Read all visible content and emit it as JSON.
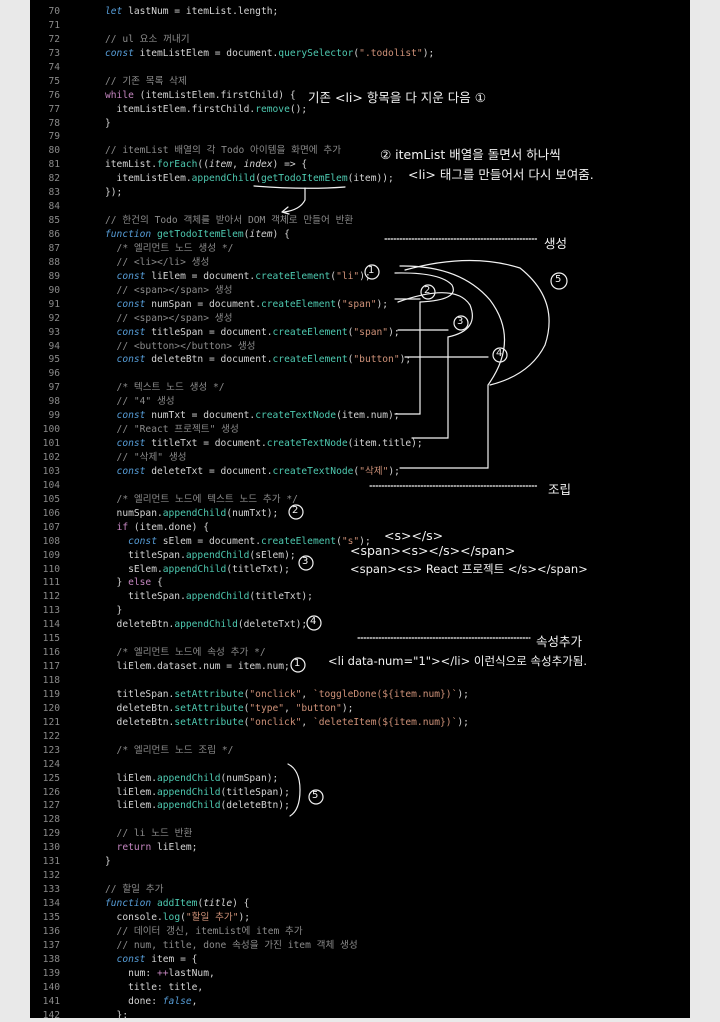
{
  "colors": {
    "background": "#000000",
    "margin": "#e9e9e9",
    "keyword": "#569cd6",
    "function": "#4ec9b0",
    "string": "#ce9178",
    "comment": "#8b8b8b",
    "text": "#d4d4d4",
    "line_number": "#8a8a8a",
    "annotation": "#f2f2f2"
  },
  "code": {
    "lines": [
      {
        "n": "70",
        "tokens": [
          [
            "let",
            "kw"
          ],
          [
            " lastNum = itemList.length;",
            ""
          ]
        ]
      },
      {
        "n": "71",
        "tokens": []
      },
      {
        "n": "72",
        "tokens": [
          [
            "// ul 요소 꺼내기",
            "cm"
          ]
        ]
      },
      {
        "n": "73",
        "tokens": [
          [
            "const",
            "kw"
          ],
          [
            " itemListElem = document.",
            ""
          ],
          [
            "querySelector",
            "fn"
          ],
          [
            "(",
            ""
          ],
          [
            "\".todolist\"",
            "str"
          ],
          [
            ");",
            ""
          ]
        ]
      },
      {
        "n": "74",
        "tokens": []
      },
      {
        "n": "75",
        "tokens": [
          [
            "// 기존 목록 삭제",
            "cm"
          ]
        ]
      },
      {
        "n": "76",
        "tokens": [
          [
            "while",
            "kw2"
          ],
          [
            " (itemListElem.firstChild) {",
            ""
          ]
        ]
      },
      {
        "n": "77",
        "tokens": [
          [
            "  itemListElem.firstChild.",
            ""
          ],
          [
            "remove",
            "fn"
          ],
          [
            "();",
            ""
          ]
        ]
      },
      {
        "n": "78",
        "tokens": [
          [
            "}",
            ""
          ]
        ]
      },
      {
        "n": "79",
        "tokens": []
      },
      {
        "n": "80",
        "tokens": [
          [
            "// itemList 배열의 각 Todo 아이템을 화면에 추가",
            "cm"
          ]
        ]
      },
      {
        "n": "81",
        "tokens": [
          [
            "itemList.",
            ""
          ],
          [
            "forEach",
            "fn"
          ],
          [
            "((",
            ""
          ],
          [
            "item",
            "param"
          ],
          [
            ", ",
            ""
          ],
          [
            "index",
            "param"
          ],
          [
            ") => {",
            ""
          ]
        ]
      },
      {
        "n": "82",
        "tokens": [
          [
            "  itemListElem.",
            ""
          ],
          [
            "appendChild",
            "fn"
          ],
          [
            "(",
            ""
          ],
          [
            "getTodoItemElem",
            "fn"
          ],
          [
            "(item));",
            ""
          ]
        ]
      },
      {
        "n": "83",
        "tokens": [
          [
            "});",
            ""
          ]
        ]
      },
      {
        "n": "84",
        "tokens": []
      },
      {
        "n": "85",
        "tokens": [
          [
            "// 한건의 Todo 객체를 받아서 DOM 객체로 만들어 반환",
            "cm"
          ]
        ]
      },
      {
        "n": "86",
        "tokens": [
          [
            "function",
            "kw"
          ],
          [
            " ",
            ""
          ],
          [
            "getTodoItemElem",
            "fn"
          ],
          [
            "(",
            ""
          ],
          [
            "item",
            "param"
          ],
          [
            ") {",
            ""
          ]
        ]
      },
      {
        "n": "87",
        "tokens": [
          [
            "  /* 엘리먼트 노드 생성 */",
            "cm"
          ]
        ]
      },
      {
        "n": "88",
        "tokens": [
          [
            "  // <li></li> 생성",
            "cm"
          ]
        ]
      },
      {
        "n": "89",
        "tokens": [
          [
            "  ",
            ""
          ],
          [
            "const",
            "kw"
          ],
          [
            " liElem = document.",
            ""
          ],
          [
            "createElement",
            "fn"
          ],
          [
            "(",
            ""
          ],
          [
            "\"li\"",
            "str"
          ],
          [
            ");",
            ""
          ]
        ]
      },
      {
        "n": "90",
        "tokens": [
          [
            "  // <span></span> 생성",
            "cm"
          ]
        ]
      },
      {
        "n": "91",
        "tokens": [
          [
            "  ",
            ""
          ],
          [
            "const",
            "kw"
          ],
          [
            " numSpan = document.",
            ""
          ],
          [
            "createElement",
            "fn"
          ],
          [
            "(",
            ""
          ],
          [
            "\"span\"",
            "str"
          ],
          [
            ");",
            ""
          ]
        ]
      },
      {
        "n": "92",
        "tokens": [
          [
            "  // <span></span> 생성",
            "cm"
          ]
        ]
      },
      {
        "n": "93",
        "tokens": [
          [
            "  ",
            ""
          ],
          [
            "const",
            "kw"
          ],
          [
            " titleSpan = document.",
            ""
          ],
          [
            "createElement",
            "fn"
          ],
          [
            "(",
            ""
          ],
          [
            "\"span\"",
            "str"
          ],
          [
            ");",
            ""
          ]
        ]
      },
      {
        "n": "94",
        "tokens": [
          [
            "  // <button></button> 생성",
            "cm"
          ]
        ]
      },
      {
        "n": "95",
        "tokens": [
          [
            "  ",
            ""
          ],
          [
            "const",
            "kw"
          ],
          [
            " deleteBtn = document.",
            ""
          ],
          [
            "createElement",
            "fn"
          ],
          [
            "(",
            ""
          ],
          [
            "\"button\"",
            "str"
          ],
          [
            ");",
            ""
          ]
        ]
      },
      {
        "n": "96",
        "tokens": []
      },
      {
        "n": "97",
        "tokens": [
          [
            "  /* 텍스트 노드 생성 */",
            "cm"
          ]
        ]
      },
      {
        "n": "98",
        "tokens": [
          [
            "  // \"4\" 생성",
            "cm"
          ]
        ]
      },
      {
        "n": "99",
        "tokens": [
          [
            "  ",
            ""
          ],
          [
            "const",
            "kw"
          ],
          [
            " numTxt = document.",
            ""
          ],
          [
            "createTextNode",
            "fn"
          ],
          [
            "(item.num);",
            ""
          ]
        ]
      },
      {
        "n": "100",
        "tokens": [
          [
            "  // \"React 프로젝트\" 생성",
            "cm"
          ]
        ]
      },
      {
        "n": "101",
        "tokens": [
          [
            "  ",
            ""
          ],
          [
            "const",
            "kw"
          ],
          [
            " titleTxt = document.",
            ""
          ],
          [
            "createTextNode",
            "fn"
          ],
          [
            "(item.title);",
            ""
          ]
        ]
      },
      {
        "n": "102",
        "tokens": [
          [
            "  // \"삭제\" 생성",
            "cm"
          ]
        ]
      },
      {
        "n": "103",
        "tokens": [
          [
            "  ",
            ""
          ],
          [
            "const",
            "kw"
          ],
          [
            " deleteTxt = document.",
            ""
          ],
          [
            "createTextNode",
            "fn"
          ],
          [
            "(",
            ""
          ],
          [
            "\"삭제\"",
            "str"
          ],
          [
            ");",
            ""
          ]
        ]
      },
      {
        "n": "104",
        "tokens": []
      },
      {
        "n": "105",
        "tokens": [
          [
            "  /* 엘리먼트 노드에 텍스트 노드 추가 */",
            "cm"
          ]
        ]
      },
      {
        "n": "106",
        "tokens": [
          [
            "  numSpan.",
            ""
          ],
          [
            "appendChild",
            "fn"
          ],
          [
            "(numTxt);",
            ""
          ]
        ]
      },
      {
        "n": "107",
        "tokens": [
          [
            "  ",
            ""
          ],
          [
            "if",
            "kw2"
          ],
          [
            " (item.done) {",
            ""
          ]
        ]
      },
      {
        "n": "108",
        "tokens": [
          [
            "    ",
            ""
          ],
          [
            "const",
            "kw"
          ],
          [
            " sElem = document.",
            ""
          ],
          [
            "createElement",
            "fn"
          ],
          [
            "(",
            ""
          ],
          [
            "\"s\"",
            "str"
          ],
          [
            ");",
            ""
          ]
        ]
      },
      {
        "n": "109",
        "tokens": [
          [
            "    titleSpan.",
            ""
          ],
          [
            "appendChild",
            "fn"
          ],
          [
            "(sElem);",
            ""
          ]
        ]
      },
      {
        "n": "110",
        "tokens": [
          [
            "    sElem.",
            ""
          ],
          [
            "appendChild",
            "fn"
          ],
          [
            "(titleTxt);",
            ""
          ]
        ]
      },
      {
        "n": "111",
        "tokens": [
          [
            "  } ",
            ""
          ],
          [
            "else",
            "kw2"
          ],
          [
            " {",
            ""
          ]
        ]
      },
      {
        "n": "112",
        "tokens": [
          [
            "    titleSpan.",
            ""
          ],
          [
            "appendChild",
            "fn"
          ],
          [
            "(titleTxt);",
            ""
          ]
        ]
      },
      {
        "n": "113",
        "tokens": [
          [
            "  }",
            ""
          ]
        ]
      },
      {
        "n": "114",
        "tokens": [
          [
            "  deleteBtn.",
            ""
          ],
          [
            "appendChild",
            "fn"
          ],
          [
            "(deleteTxt);",
            ""
          ]
        ]
      },
      {
        "n": "115",
        "tokens": []
      },
      {
        "n": "116",
        "tokens": [
          [
            "  /* 엘리먼트 노드에 속성 추가 */",
            "cm"
          ]
        ]
      },
      {
        "n": "117",
        "tokens": [
          [
            "  liElem.dataset.num = item.num;",
            ""
          ]
        ]
      },
      {
        "n": "118",
        "tokens": []
      },
      {
        "n": "119",
        "tokens": [
          [
            "  titleSpan.",
            ""
          ],
          [
            "setAttribute",
            "fn"
          ],
          [
            "(",
            ""
          ],
          [
            "\"onclick\"",
            "str"
          ],
          [
            ", ",
            ""
          ],
          [
            "`toggleDone(${item.num})`",
            "str"
          ],
          [
            ");",
            ""
          ]
        ]
      },
      {
        "n": "120",
        "tokens": [
          [
            "  deleteBtn.",
            ""
          ],
          [
            "setAttribute",
            "fn"
          ],
          [
            "(",
            ""
          ],
          [
            "\"type\"",
            "str"
          ],
          [
            ", ",
            ""
          ],
          [
            "\"button\"",
            "str"
          ],
          [
            ");",
            ""
          ]
        ]
      },
      {
        "n": "121",
        "tokens": [
          [
            "  deleteBtn.",
            ""
          ],
          [
            "setAttribute",
            "fn"
          ],
          [
            "(",
            ""
          ],
          [
            "\"onclick\"",
            "str"
          ],
          [
            ", ",
            ""
          ],
          [
            "`deleteItem(${item.num})`",
            "str"
          ],
          [
            ");",
            ""
          ]
        ]
      },
      {
        "n": "122",
        "tokens": []
      },
      {
        "n": "123",
        "tokens": [
          [
            "  /* 엘리먼트 노드 조립 */",
            "cm"
          ]
        ]
      },
      {
        "n": "124",
        "tokens": []
      },
      {
        "n": "125",
        "tokens": [
          [
            "  liElem.",
            ""
          ],
          [
            "appendChild",
            "fn"
          ],
          [
            "(numSpan);",
            ""
          ]
        ]
      },
      {
        "n": "126",
        "tokens": [
          [
            "  liElem.",
            ""
          ],
          [
            "appendChild",
            "fn"
          ],
          [
            "(titleSpan);",
            ""
          ]
        ]
      },
      {
        "n": "127",
        "tokens": [
          [
            "  liElem.",
            ""
          ],
          [
            "appendChild",
            "fn"
          ],
          [
            "(deleteBtn);",
            ""
          ]
        ]
      },
      {
        "n": "128",
        "tokens": []
      },
      {
        "n": "129",
        "tokens": [
          [
            "  // li 노드 반환",
            "cm"
          ]
        ]
      },
      {
        "n": "130",
        "tokens": [
          [
            "  ",
            ""
          ],
          [
            "return",
            "kw2"
          ],
          [
            " liElem;",
            ""
          ]
        ]
      },
      {
        "n": "131",
        "tokens": [
          [
            "}",
            ""
          ]
        ]
      },
      {
        "n": "132",
        "tokens": []
      },
      {
        "n": "133",
        "tokens": [
          [
            "// 할일 추가",
            "cm"
          ]
        ]
      },
      {
        "n": "134",
        "tokens": [
          [
            "function",
            "kw"
          ],
          [
            " ",
            ""
          ],
          [
            "addItem",
            "fn"
          ],
          [
            "(",
            ""
          ],
          [
            "title",
            "param"
          ],
          [
            ") {",
            ""
          ]
        ]
      },
      {
        "n": "135",
        "tokens": [
          [
            "  console.",
            ""
          ],
          [
            "log",
            "fn"
          ],
          [
            "(",
            ""
          ],
          [
            "\"할일 추가\"",
            "str"
          ],
          [
            ");",
            ""
          ]
        ]
      },
      {
        "n": "136",
        "tokens": [
          [
            "  // 데이터 갱신, itemList에 item 추가",
            "cm"
          ]
        ]
      },
      {
        "n": "137",
        "tokens": [
          [
            "  // num, title, done 속성을 가진 item 객체 생성",
            "cm"
          ]
        ]
      },
      {
        "n": "138",
        "tokens": [
          [
            "  ",
            ""
          ],
          [
            "const",
            "kw"
          ],
          [
            " item = {",
            ""
          ]
        ]
      },
      {
        "n": "139",
        "tokens": [
          [
            "    num: ",
            ""
          ],
          [
            "++",
            "kw2"
          ],
          [
            "lastNum,",
            ""
          ]
        ]
      },
      {
        "n": "140",
        "tokens": [
          [
            "    title: title,",
            ""
          ]
        ]
      },
      {
        "n": "141",
        "tokens": [
          [
            "    done: ",
            ""
          ],
          [
            "false",
            "kw"
          ],
          [
            ",",
            ""
          ]
        ]
      },
      {
        "n": "142",
        "tokens": [
          [
            "  };",
            ""
          ]
        ]
      }
    ]
  },
  "annotations": {
    "delete_existing": "기존 <li> 항목을 다 지운 다음 ①",
    "foreach_note_1": "② itemList 배열을 돌면서 하나씩",
    "foreach_note_2": "<li> 태그를 만들어서 다시 보여줌.",
    "create": "생성",
    "assemble": "조립",
    "s_tag_1": "<s></s>",
    "s_tag_2": "<span><s></s></span>",
    "s_tag_3": "<span><s> React 프로젝트 </s></span>",
    "add_attr": "속성추가",
    "dataset_note": "<li data-num=\"1\"></li> 이런식으로 속성추가됨.",
    "num_1": "1",
    "num_2": "2",
    "num_3": "3",
    "num_4": "4",
    "num_5": "5"
  }
}
